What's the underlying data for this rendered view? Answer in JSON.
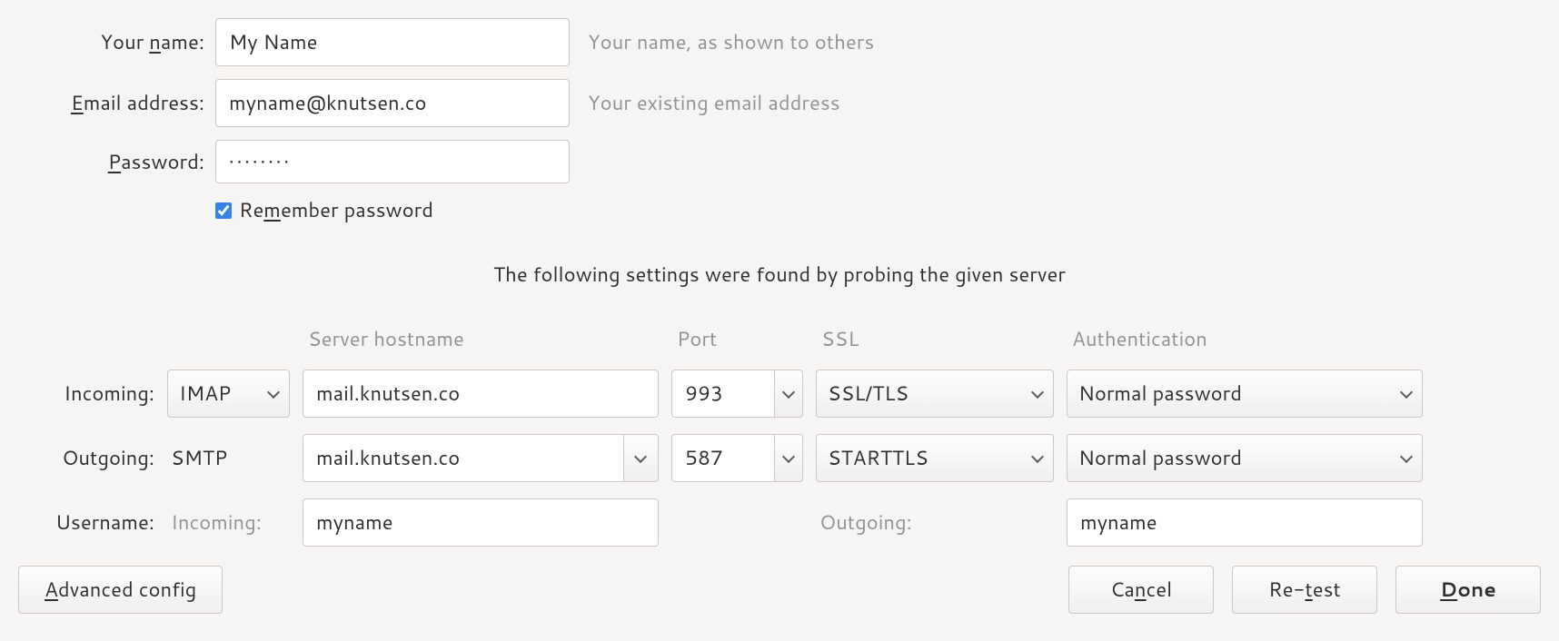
{
  "form": {
    "name_label": "ame:",
    "name_value": "My Name",
    "name_hint": "Your name, as shown to others",
    "email_label": "mail address:",
    "email_value": "myname@knutsen.co",
    "email_hint": "Your existing email address",
    "password_label": "assword:",
    "password_value": "••••••••",
    "remember_label": "ember password"
  },
  "status_message": "The following settings were found by probing the given server",
  "headers": {
    "server_hostname": "Server hostname",
    "port": "Port",
    "ssl": "SSL",
    "authentication": "Authentication"
  },
  "incoming": {
    "label": "Incoming:",
    "protocol": "IMAP",
    "hostname": "mail.knutsen.co",
    "port": "993",
    "ssl": "SSL/TLS",
    "auth": "Normal password"
  },
  "outgoing": {
    "label": "Outgoing:",
    "protocol": "SMTP",
    "hostname": "mail.knutsen.co",
    "port": "587",
    "ssl": "STARTTLS",
    "auth": "Normal password"
  },
  "username": {
    "label": "Username:",
    "incoming_label": "Incoming:",
    "incoming_value": "myname",
    "outgoing_label": "Outgoing:",
    "outgoing_value": "myname"
  },
  "buttons": {
    "advanced": "dvanced config",
    "cancel": "cel",
    "retest": "est",
    "done": "one"
  }
}
